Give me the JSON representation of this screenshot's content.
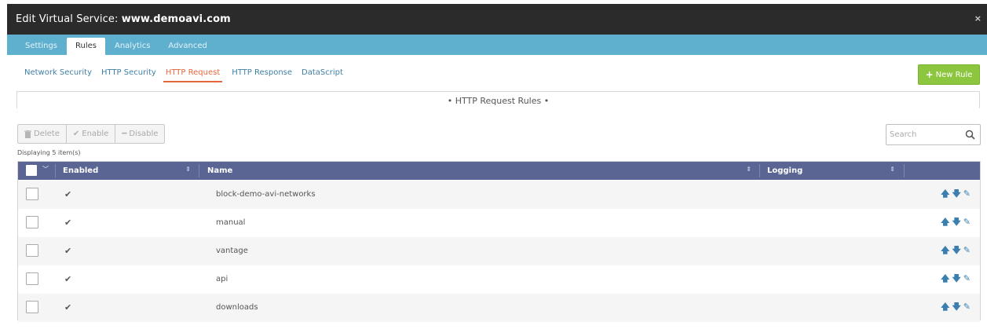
{
  "titlebar": {
    "prefix": "Edit Virtual Service: ",
    "name": "www.demoavi.com",
    "close": "×"
  },
  "main_tabs": [
    {
      "label": "Settings"
    },
    {
      "label": "Rules"
    },
    {
      "label": "Analytics"
    },
    {
      "label": "Advanced"
    }
  ],
  "main_tabs_active": "Rules",
  "sub_tabs": [
    {
      "label": "Network Security"
    },
    {
      "label": "HTTP Security"
    },
    {
      "label": "HTTP Request"
    },
    {
      "label": "HTTP Response"
    },
    {
      "label": "DataScript"
    }
  ],
  "sub_tabs_active": "HTTP Request",
  "new_rule": {
    "label": "New Rule",
    "icon": "plus-icon",
    "color": "#8cc63f"
  },
  "section": {
    "title": "• HTTP Request Rules •"
  },
  "actions": {
    "delete": "Delete",
    "enable": "Enable",
    "disable": "Disable"
  },
  "displaying": "Displaying 5 item(s)",
  "search": {
    "placeholder": "Search"
  },
  "table": {
    "header_color": "#5b6593",
    "columns": [
      "Enabled",
      "Name",
      "Logging"
    ],
    "rows": [
      {
        "enabled": true,
        "name": "block-demo-avi-networks",
        "logging": ""
      },
      {
        "enabled": true,
        "name": "manual",
        "logging": ""
      },
      {
        "enabled": true,
        "name": "vantage",
        "logging": ""
      },
      {
        "enabled": true,
        "name": "api",
        "logging": ""
      },
      {
        "enabled": true,
        "name": "downloads",
        "logging": ""
      }
    ]
  },
  "accent_colors": {
    "title_bar": "#2b2b2b",
    "tab_bar": "#5fb0cf",
    "active_subtab": "#e8663d",
    "link": "#3e7fa6"
  }
}
